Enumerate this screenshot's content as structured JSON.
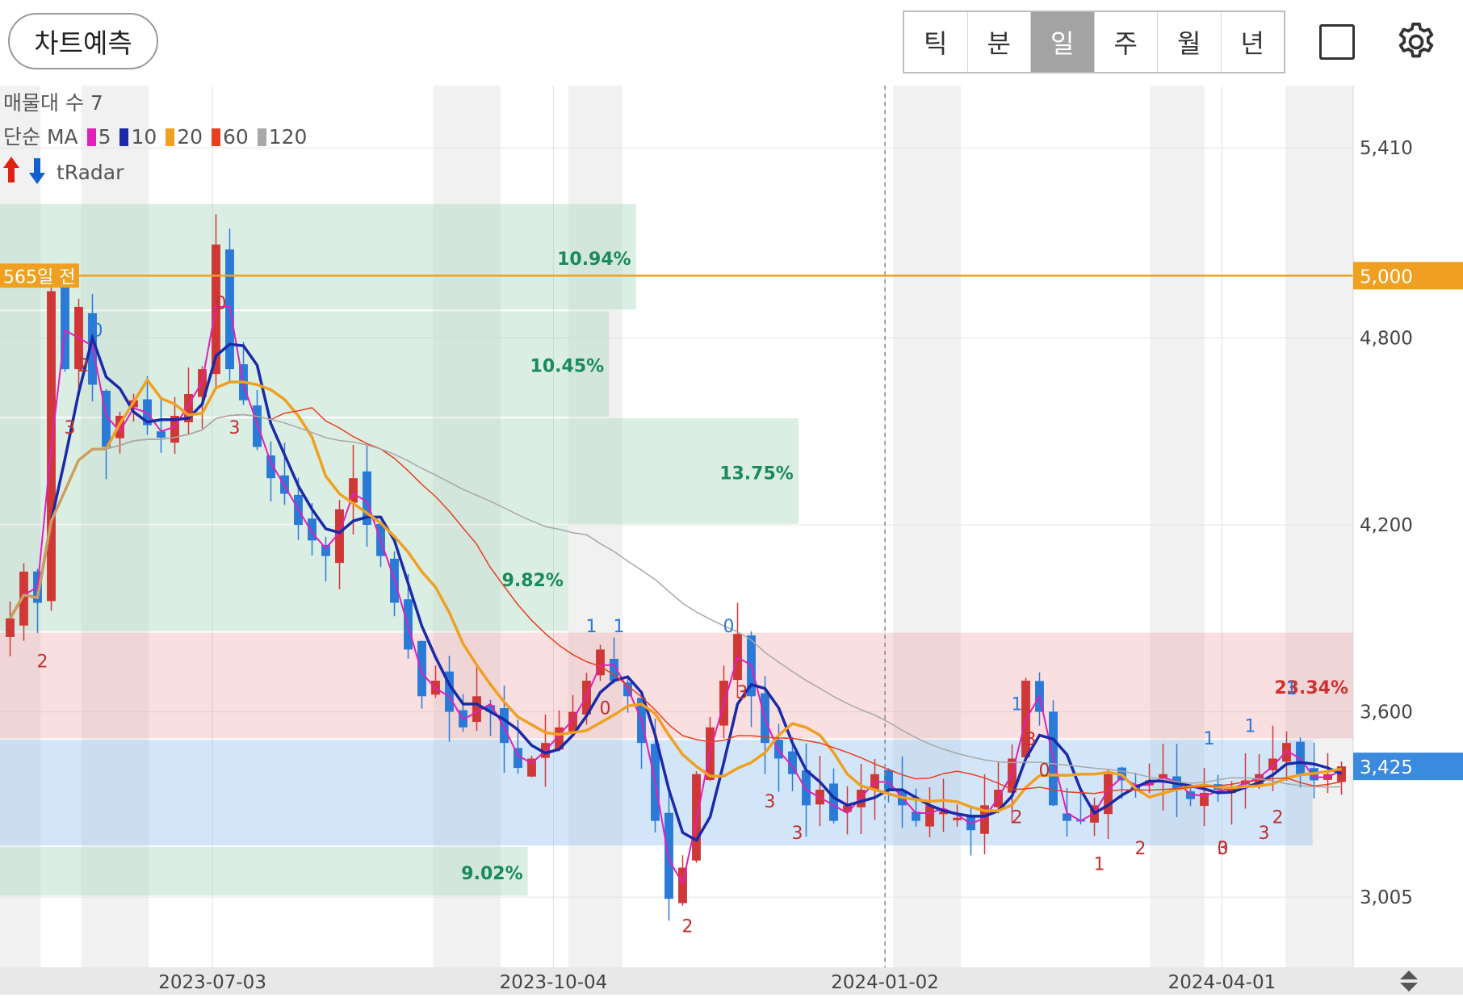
{
  "toolbar": {
    "predict_label": "차트예측",
    "periods": [
      {
        "label": "틱",
        "active": false
      },
      {
        "label": "분",
        "active": false
      },
      {
        "label": "일",
        "active": true
      },
      {
        "label": "주",
        "active": false
      },
      {
        "label": "월",
        "active": false
      },
      {
        "label": "년",
        "active": false
      }
    ]
  },
  "legend": {
    "volume_profile": "매물대 수 7",
    "ma_title": "단순 MA",
    "ma": [
      {
        "period": "5",
        "color": "#e020b8"
      },
      {
        "period": "10",
        "color": "#1a2aa8"
      },
      {
        "period": "20",
        "color": "#f0a020"
      },
      {
        "period": "60",
        "color": "#e84020"
      },
      {
        "period": "120",
        "color": "#a8a8a8"
      }
    ],
    "tradar": "tRadar"
  },
  "annotations": {
    "days_ago_label": "565일 전",
    "level_line_value": "5,000",
    "current_price": "3,425"
  },
  "chart_data": {
    "type": "candlestick",
    "y_axis_ticks": [
      "5,410",
      "4,800",
      "4,200",
      "3,600",
      "3,005"
    ],
    "x_axis_ticks": [
      "2023-07-03",
      "2023-10-04",
      "2024-01-02",
      "2024-04-01"
    ],
    "ylim": [
      2780,
      5610
    ],
    "level_line": 5000,
    "current_price": 3425,
    "volume_profile": [
      {
        "low": 4886,
        "high": 5230,
        "percent": "10.94%",
        "color": "green"
      },
      {
        "low": 4542,
        "high": 4886,
        "percent": "10.45%",
        "color": "green"
      },
      {
        "low": 4198,
        "high": 4542,
        "percent": "13.75%",
        "color": "green"
      },
      {
        "low": 3854,
        "high": 4198,
        "percent": "9.82%",
        "color": "green"
      },
      {
        "low": 3510,
        "high": 3854,
        "percent": "23.34%",
        "color": "red"
      },
      {
        "low": 3166,
        "high": 3510,
        "percent": "",
        "color": "blue"
      },
      {
        "low": 3005,
        "high": 3166,
        "percent": "9.02%",
        "color": "green"
      }
    ],
    "close_series": [
      3900,
      4050,
      3950,
      4950,
      4700,
      4900,
      4650,
      4450,
      4550,
      4600,
      4520,
      4480,
      4550,
      4620,
      4700,
      5100,
      4700,
      4600,
      4450,
      4350,
      4300,
      4200,
      4150,
      4100,
      4250,
      4350,
      4200,
      4100,
      3950,
      3800,
      3650,
      3700,
      3600,
      3550,
      3650,
      3600,
      3500,
      3420,
      3450,
      3500,
      3550,
      3600,
      3700,
      3800,
      3700,
      3650,
      3500,
      3250,
      3000,
      3100,
      3400,
      3550,
      3700,
      3850,
      3650,
      3500,
      3450,
      3400,
      3300,
      3350,
      3250,
      3300,
      3350,
      3400,
      3350,
      3300,
      3250,
      3300,
      3280,
      3260,
      3220,
      3300,
      3350,
      3450,
      3700,
      3600,
      3300,
      3250,
      3250,
      3300,
      3400,
      3380,
      3350,
      3380,
      3400,
      3350,
      3320,
      3340,
      3350,
      3360,
      3380,
      3400,
      3450,
      3500,
      3400,
      3380,
      3400,
      3425
    ],
    "series": [
      {
        "name": "5",
        "color": "#e020b8"
      },
      {
        "name": "10",
        "color": "#1a2aa8"
      },
      {
        "name": "20",
        "color": "#f0a020"
      },
      {
        "name": "60",
        "color": "#e84020"
      },
      {
        "name": "120",
        "color": "#a8a8a8"
      }
    ],
    "signals": [
      "3",
      "2",
      "0",
      "0",
      "3",
      "2",
      "1",
      "0",
      "1",
      "2",
      "0",
      "3",
      "3",
      "1",
      "3",
      "2",
      "1",
      "0",
      "3",
      "2",
      "1",
      "0",
      "1",
      "3",
      "3",
      "2",
      "1"
    ]
  }
}
